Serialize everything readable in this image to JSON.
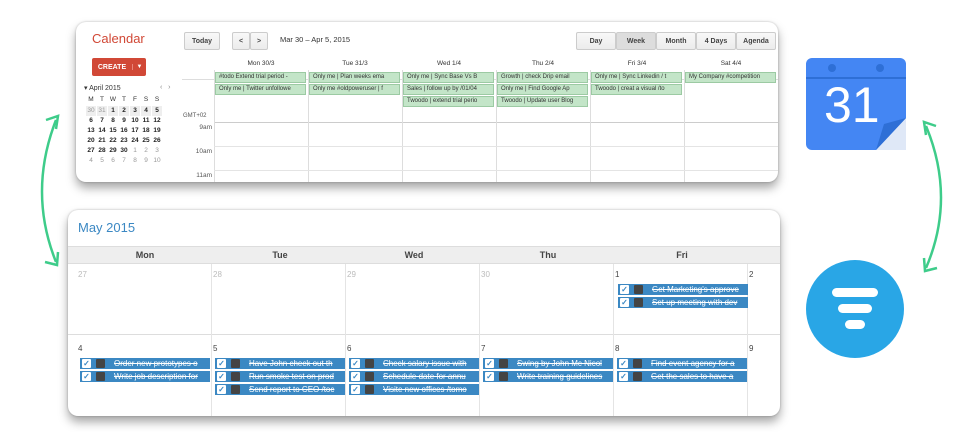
{
  "top": {
    "title": "Calendar",
    "today": "Today",
    "prev": "<",
    "next": ">",
    "range": "Mar 30 – Apr 5, 2015",
    "views": [
      "Day",
      "Week",
      "Month",
      "4 Days",
      "Agenda"
    ],
    "create": "CREATE",
    "create_caret": "▼",
    "mini_month": "April 2015",
    "mini_headers": [
      "M",
      "T",
      "W",
      "T",
      "F",
      "S",
      "S"
    ],
    "mini_rows": [
      [
        "30",
        "31",
        "1",
        "2",
        "3",
        "4",
        "5"
      ],
      [
        "6",
        "7",
        "8",
        "9",
        "10",
        "11",
        "12"
      ],
      [
        "13",
        "14",
        "15",
        "16",
        "17",
        "18",
        "19"
      ],
      [
        "20",
        "21",
        "22",
        "23",
        "24",
        "25",
        "26"
      ],
      [
        "27",
        "28",
        "29",
        "30",
        "1",
        "2",
        "3"
      ],
      [
        "4",
        "5",
        "6",
        "7",
        "8",
        "9",
        "10"
      ]
    ],
    "days": [
      "Mon 30/3",
      "Tue 31/3",
      "Wed 1/4",
      "Thu 2/4",
      "Fri 3/4",
      "Sat 4/4"
    ],
    "timezone": "GMT+02",
    "times": [
      "9am",
      "10am",
      "11am"
    ],
    "events": [
      [
        "#todo Extend trial period -",
        "Only me | Twitter unfollowe"
      ],
      [
        "Only me | Plan weeks ema",
        "Only me #oldpoweruser | f"
      ],
      [
        "Only me | Sync Base Vs B",
        "Sales | follow up by /01/04",
        "Twoodo | extend trial perio"
      ],
      [
        "Growth | check Drip email",
        "Only me | Find Google Ap",
        "Twoodo | Update user Blog"
      ],
      [
        "Only me | Sync Linkedin / t",
        "Twoodo | creat a visual /to"
      ],
      [
        "My Company #competition"
      ]
    ]
  },
  "bottom": {
    "month": "May 2015",
    "weekdays": [
      "Mon",
      "Tue",
      "Wed",
      "Thu",
      "Fri"
    ],
    "week1_days": [
      "27",
      "28",
      "29",
      "30",
      "1",
      "2"
    ],
    "week2_days": [
      "4",
      "5",
      "6",
      "7",
      "8",
      "9"
    ],
    "fri1_tasks": [
      "Get Marketing's approve",
      "Set up meeting with dev"
    ],
    "week2_tasks": [
      [
        "Order new prototypes o",
        "Write job description for"
      ],
      [
        "Have John check out th",
        "Run smoke test on prod",
        "Send report to CEO /toc"
      ],
      [
        "Check salary issue with",
        "Schedule date for annu",
        "Visite new offices /tomo"
      ],
      [
        "Swing by John Mc Nicol",
        "Write training guidelines"
      ],
      [
        "Find event agency for a",
        "Get the sales to have a"
      ]
    ]
  },
  "colors": {
    "gcal_blue": "#4486f3",
    "twoodo_blue": "#29a6e6",
    "arrow_green": "#3ecc8a",
    "task_blue": "#3b88c3",
    "event_green": "#c3e5c8"
  },
  "icons": [
    "google-calendar-icon",
    "twoodo-filter-icon",
    "sync-arrow-icon"
  ],
  "gcal_icon_text": "31"
}
